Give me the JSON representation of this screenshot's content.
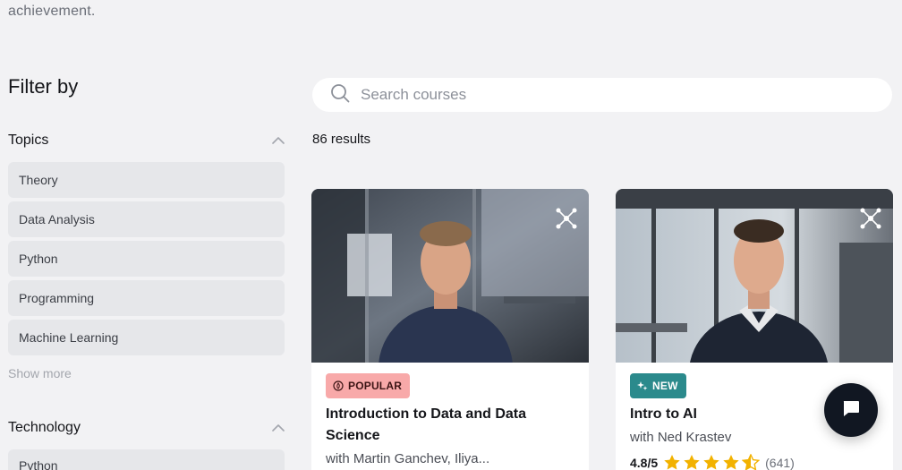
{
  "intro": {
    "tail_text": "achievement."
  },
  "filters": {
    "title": "Filter by",
    "topics": {
      "label": "Topics",
      "items": [
        "Theory",
        "Data Analysis",
        "Python",
        "Programming",
        "Machine Learning"
      ],
      "show_more": "Show more"
    },
    "technology": {
      "label": "Technology",
      "items": [
        "Python"
      ]
    }
  },
  "search": {
    "placeholder": "Search courses",
    "value": "",
    "icon": "search-icon"
  },
  "results": {
    "label": "86 results"
  },
  "courses": [
    {
      "badge": "POPULAR",
      "badge_icon": "fire-icon",
      "title": "Introduction to Data and Data Science",
      "instructor": "with Martin Ganchev, Iliya..."
    },
    {
      "badge": "NEW",
      "badge_icon": "sparkle-icon",
      "title": "Intro to AI",
      "instructor": "with Ned Krastev",
      "rating": "4.8/5",
      "stars": 4.5,
      "rating_count": "(641)"
    }
  ],
  "colors": {
    "background": "#f2f2f4",
    "popular_badge": "#f8a9a9",
    "new_badge": "#2b8a8c",
    "star": "#f2b200",
    "chat_button": "#111722"
  },
  "chat": {
    "icon": "chat-bubble-icon"
  }
}
